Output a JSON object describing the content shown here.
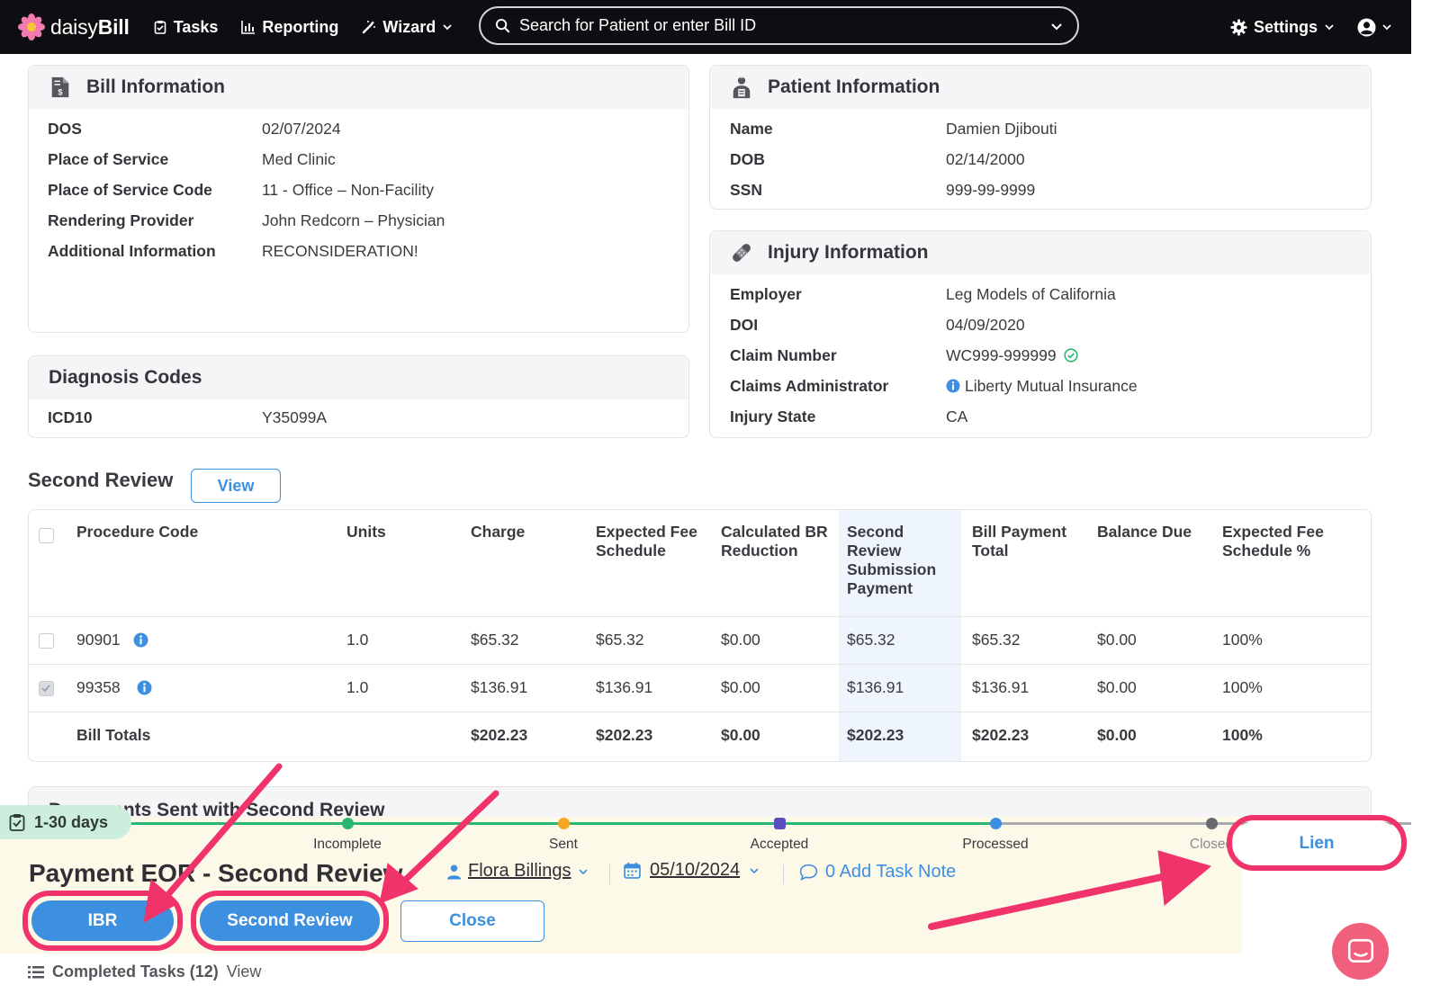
{
  "nav": {
    "brand_light": "daisy",
    "brand_bold": "Bill",
    "tasks": "Tasks",
    "reporting": "Reporting",
    "wizard": "Wizard",
    "search_placeholder": "Search for Patient or enter Bill ID",
    "settings": "Settings"
  },
  "bill_info": {
    "title": "Bill Information",
    "rows": [
      {
        "label": "DOS",
        "value": "02/07/2024"
      },
      {
        "label": "Place of Service",
        "value": "Med Clinic"
      },
      {
        "label": "Place of Service Code",
        "value": "11 - Office – Non-Facility"
      },
      {
        "label": "Rendering Provider",
        "value": "John Redcorn – Physician"
      },
      {
        "label": "Additional Information",
        "value": "RECONSIDERATION!"
      }
    ]
  },
  "patient_info": {
    "title": "Patient Information",
    "rows": [
      {
        "label": "Name",
        "value": "Damien Djibouti"
      },
      {
        "label": "DOB",
        "value": "02/14/2000"
      },
      {
        "label": "SSN",
        "value": "999-99-9999"
      }
    ]
  },
  "injury_info": {
    "title": "Injury Information",
    "rows": [
      {
        "label": "Employer",
        "value": "Leg Models of California"
      },
      {
        "label": "DOI",
        "value": "04/09/2020"
      },
      {
        "label": "Claim Number",
        "value": "WC999-999999"
      },
      {
        "label": "Claims Administrator",
        "value": "Liberty Mutual Insurance"
      },
      {
        "label": "Injury State",
        "value": "CA"
      }
    ]
  },
  "diagnosis": {
    "title": "Diagnosis Codes",
    "label": "ICD10",
    "value": "Y35099A"
  },
  "second_review": {
    "title": "Second Review",
    "view_button": "View"
  },
  "table": {
    "headers": [
      "Procedure Code",
      "Units",
      "Charge",
      "Expected Fee Schedule",
      "Calculated BR Reduction",
      "Second Review Submission Payment",
      "Bill Payment Total",
      "Balance Due",
      "Expected Fee Schedule %"
    ],
    "rows": [
      {
        "code": "90901",
        "units": "1.0",
        "charge": "$65.32",
        "efs": "$65.32",
        "br": "$0.00",
        "srsp": "$65.32",
        "bpt": "$65.32",
        "due": "$0.00",
        "pct": "100%",
        "checked": false
      },
      {
        "code": "99358",
        "units": "1.0",
        "charge": "$136.91",
        "efs": "$136.91",
        "br": "$0.00",
        "srsp": "$136.91",
        "bpt": "$136.91",
        "due": "$0.00",
        "pct": "100%",
        "checked": true
      }
    ],
    "totals": {
      "label": "Bill Totals",
      "charge": "$202.23",
      "efs": "$202.23",
      "br": "$0.00",
      "srsp": "$202.23",
      "bpt": "$202.23",
      "due": "$0.00",
      "pct": "100%"
    }
  },
  "documents": {
    "title": "Documents Sent with Second Review"
  },
  "task": {
    "days_badge": "1-30 days",
    "stages": [
      "Incomplete",
      "Sent",
      "Accepted",
      "Processed",
      "Closed"
    ],
    "title": "Payment EOR - Second Review",
    "assignee": "Flora Billings",
    "date": "05/10/2024",
    "task_note": "0 Add Task Note",
    "buttons": {
      "ibr": "IBR",
      "second_review": "Second Review",
      "close": "Close",
      "lien": "Lien"
    },
    "completed_label": "Completed Tasks (12)",
    "completed_view": "View"
  },
  "colors": {
    "accent": "#3d8fe0",
    "highlight": "#f0336b",
    "task_bg": "#fdf9e8",
    "nav_bg": "#0e0e12"
  }
}
